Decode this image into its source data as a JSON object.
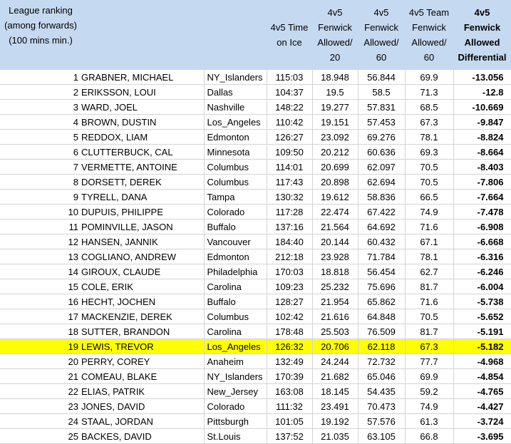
{
  "headers": {
    "rank": "League ranking (among forwards) (100 mins min.)",
    "player": "",
    "team": "",
    "toi": "4v5 Time on Ice",
    "fa20": "4v5 Fenwick Allowed/ 20",
    "fa60": "4v5 Fenwick Allowed/ 60",
    "team_fa60": "4v5 Team Fenwick Allowed/ 60",
    "diff": "4v5 Fenwick Allowed Differential"
  },
  "highlight_color": "#ffff00",
  "header_color": "#c5d9f1",
  "rows": [
    {
      "rank": "1",
      "player": "GRABNER, MICHAEL",
      "team": "NY_Islanders",
      "toi": "115:03",
      "fa20": "18.948",
      "fa60": "56.844",
      "team_fa60": "69.9",
      "diff": "-13.056",
      "highlight": false
    },
    {
      "rank": "2",
      "player": "ERIKSSON, LOUI",
      "team": "Dallas",
      "toi": "104:37",
      "fa20": "19.5",
      "fa60": "58.5",
      "team_fa60": "71.3",
      "diff": "-12.8",
      "highlight": false
    },
    {
      "rank": "3",
      "player": "WARD, JOEL",
      "team": "Nashville",
      "toi": "148:22",
      "fa20": "19.277",
      "fa60": "57.831",
      "team_fa60": "68.5",
      "diff": "-10.669",
      "highlight": false
    },
    {
      "rank": "4",
      "player": "BROWN, DUSTIN",
      "team": "Los_Angeles",
      "toi": "110:42",
      "fa20": "19.151",
      "fa60": "57.453",
      "team_fa60": "67.3",
      "diff": "-9.847",
      "highlight": false
    },
    {
      "rank": "5",
      "player": "REDDOX, LIAM",
      "team": "Edmonton",
      "toi": "126:27",
      "fa20": "23.092",
      "fa60": "69.276",
      "team_fa60": "78.1",
      "diff": "-8.824",
      "highlight": false
    },
    {
      "rank": "6",
      "player": "CLUTTERBUCK, CAL",
      "team": "Minnesota",
      "toi": "109:50",
      "fa20": "20.212",
      "fa60": "60.636",
      "team_fa60": "69.3",
      "diff": "-8.664",
      "highlight": false
    },
    {
      "rank": "7",
      "player": "VERMETTE, ANTOINE",
      "team": "Columbus",
      "toi": "114:01",
      "fa20": "20.699",
      "fa60": "62.097",
      "team_fa60": "70.5",
      "diff": "-8.403",
      "highlight": false
    },
    {
      "rank": "8",
      "player": "DORSETT, DEREK",
      "team": "Columbus",
      "toi": "117:43",
      "fa20": "20.898",
      "fa60": "62.694",
      "team_fa60": "70.5",
      "diff": "-7.806",
      "highlight": false
    },
    {
      "rank": "9",
      "player": "TYRELL, DANA",
      "team": "Tampa",
      "toi": "130:32",
      "fa20": "19.612",
      "fa60": "58.836",
      "team_fa60": "66.5",
      "diff": "-7.664",
      "highlight": false
    },
    {
      "rank": "10",
      "player": "DUPUIS, PHILIPPE",
      "team": "Colorado",
      "toi": "117:28",
      "fa20": "22.474",
      "fa60": "67.422",
      "team_fa60": "74.9",
      "diff": "-7.478",
      "highlight": false
    },
    {
      "rank": "11",
      "player": "POMINVILLE, JASON",
      "team": "Buffalo",
      "toi": "137:16",
      "fa20": "21.564",
      "fa60": "64.692",
      "team_fa60": "71.6",
      "diff": "-6.908",
      "highlight": false
    },
    {
      "rank": "12",
      "player": "HANSEN, JANNIK",
      "team": "Vancouver",
      "toi": "184:40",
      "fa20": "20.144",
      "fa60": "60.432",
      "team_fa60": "67.1",
      "diff": "-6.668",
      "highlight": false
    },
    {
      "rank": "13",
      "player": "COGLIANO, ANDREW",
      "team": "Edmonton",
      "toi": "212:18",
      "fa20": "23.928",
      "fa60": "71.784",
      "team_fa60": "78.1",
      "diff": "-6.316",
      "highlight": false
    },
    {
      "rank": "14",
      "player": "GIROUX, CLAUDE",
      "team": "Philadelphia",
      "toi": "170:03",
      "fa20": "18.818",
      "fa60": "56.454",
      "team_fa60": "62.7",
      "diff": "-6.246",
      "highlight": false
    },
    {
      "rank": "15",
      "player": "COLE, ERIK",
      "team": "Carolina",
      "toi": "109:23",
      "fa20": "25.232",
      "fa60": "75.696",
      "team_fa60": "81.7",
      "diff": "-6.004",
      "highlight": false
    },
    {
      "rank": "16",
      "player": "HECHT, JOCHEN",
      "team": "Buffalo",
      "toi": "128:27",
      "fa20": "21.954",
      "fa60": "65.862",
      "team_fa60": "71.6",
      "diff": "-5.738",
      "highlight": false
    },
    {
      "rank": "17",
      "player": "MACKENZIE, DEREK",
      "team": "Columbus",
      "toi": "102:42",
      "fa20": "21.616",
      "fa60": "64.848",
      "team_fa60": "70.5",
      "diff": "-5.652",
      "highlight": false
    },
    {
      "rank": "18",
      "player": "SUTTER, BRANDON",
      "team": "Carolina",
      "toi": "178:48",
      "fa20": "25.503",
      "fa60": "76.509",
      "team_fa60": "81.7",
      "diff": "-5.191",
      "highlight": false
    },
    {
      "rank": "19",
      "player": "LEWIS, TREVOR",
      "team": "Los_Angeles",
      "toi": "126:32",
      "fa20": "20.706",
      "fa60": "62.118",
      "team_fa60": "67.3",
      "diff": "-5.182",
      "highlight": true
    },
    {
      "rank": "20",
      "player": "PERRY, COREY",
      "team": "Anaheim",
      "toi": "132:49",
      "fa20": "24.244",
      "fa60": "72.732",
      "team_fa60": "77.7",
      "diff": "-4.968",
      "highlight": false
    },
    {
      "rank": "21",
      "player": "COMEAU, BLAKE",
      "team": "NY_Islanders",
      "toi": "170:39",
      "fa20": "21.682",
      "fa60": "65.046",
      "team_fa60": "69.9",
      "diff": "-4.854",
      "highlight": false
    },
    {
      "rank": "22",
      "player": "ELIAS, PATRIK",
      "team": "New_Jersey",
      "toi": "163:08",
      "fa20": "18.145",
      "fa60": "54.435",
      "team_fa60": "59.2",
      "diff": "-4.765",
      "highlight": false
    },
    {
      "rank": "23",
      "player": "JONES, DAVID",
      "team": "Colorado",
      "toi": "111:32",
      "fa20": "23.491",
      "fa60": "70.473",
      "team_fa60": "74.9",
      "diff": "-4.427",
      "highlight": false
    },
    {
      "rank": "24",
      "player": "STAAL, JORDAN",
      "team": "Pittsburgh",
      "toi": "101:05",
      "fa20": "19.192",
      "fa60": "57.576",
      "team_fa60": "61.3",
      "diff": "-3.724",
      "highlight": false
    },
    {
      "rank": "25",
      "player": "BACKES, DAVID",
      "team": "St.Louis",
      "toi": "137:52",
      "fa20": "21.035",
      "fa60": "63.105",
      "team_fa60": "66.8",
      "diff": "-3.695",
      "highlight": false
    }
  ]
}
